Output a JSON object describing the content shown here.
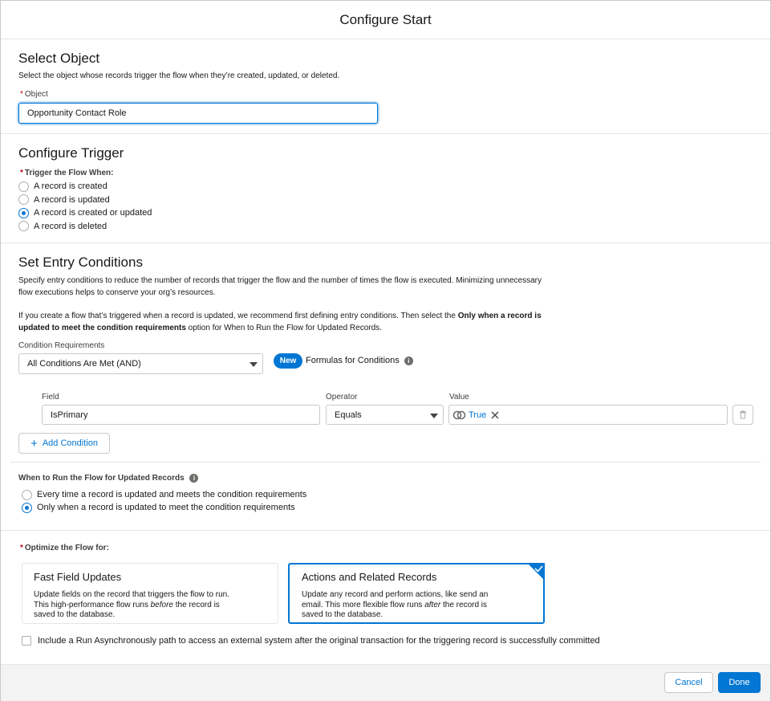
{
  "modal": {
    "title": "Configure Start"
  },
  "select_object": {
    "title": "Select Object",
    "description": "Select the object whose records trigger the flow when they’re created, updated, or deleted.",
    "required_mark": "*",
    "object_label": "Object",
    "object_value": "Opportunity Contact Role"
  },
  "trigger": {
    "title": "Configure Trigger",
    "required_mark": "*",
    "label": "Trigger the Flow When:",
    "options": [
      {
        "label": "A record is created",
        "selected": false
      },
      {
        "label": "A record is updated",
        "selected": false
      },
      {
        "label": "A record is created or updated",
        "selected": true
      },
      {
        "label": "A record is deleted",
        "selected": false
      }
    ]
  },
  "entry": {
    "title": "Set Entry Conditions",
    "desc1_line1": "Specify entry conditions to reduce the number of records that trigger the flow and the number of times the flow is executed. Minimizing unnecessary",
    "desc1_line2": "flow executions helps to conserve your org’s resources.",
    "desc2_part1": "If you create a flow that’s triggered when a record is updated, we recommend first defining entry conditions. Then select the ",
    "desc2_bold1": "Only when a record is",
    "desc2_bold2": "updated to meet the condition requirements",
    "desc2_part2": " option for When to Run the Flow for Updated Records.",
    "cond_req_label": "Condition Requirements",
    "cond_req_value": "All Conditions Are Met (AND)",
    "new_badge": "New",
    "formulas_label": "Formulas for Conditions",
    "info_glyph": "i",
    "col_field": "Field",
    "col_operator": "Operator",
    "col_value": "Value",
    "row": {
      "field": "IsPrimary",
      "operator": "Equals",
      "value": "True"
    },
    "add_condition_plus": "+",
    "add_condition": "Add Condition"
  },
  "when_run": {
    "label": "When to Run the Flow for Updated Records",
    "info_glyph": "i",
    "options": [
      {
        "label": "Every time a record is updated and meets the condition requirements",
        "selected": false
      },
      {
        "label": "Only when a record is updated to meet the condition requirements",
        "selected": true
      }
    ]
  },
  "optimize": {
    "required_mark": "*",
    "label": "Optimize the Flow for:",
    "card1": {
      "title": "Fast Field Updates",
      "line1": "Update fields on the record that triggers the flow to run.",
      "line2": "This high-performance flow runs ",
      "line2_em": "before",
      "line2_end": " the record is",
      "line3": "saved to the database."
    },
    "card2": {
      "title": "Actions and Related Records",
      "line1": "Update any record and perform actions, like send an",
      "line2": "email. This more flexible flow runs ",
      "line2_em": "after",
      "line2_end": " the record is",
      "line3": "saved to the database."
    },
    "async_label": "Include a Run Asynchronously path to access an external system after the original transaction for the triggering record is successfully committed"
  },
  "footer": {
    "cancel": "Cancel",
    "done": "Done"
  },
  "colors": {
    "brand": "#0176d3",
    "required": "#ba0517",
    "border": "#c9c9c9"
  },
  "icons": [
    "info-icon",
    "trash-icon",
    "close-icon",
    "chevron-down-icon",
    "checkmark-icon",
    "add-icon",
    "link-icon"
  ]
}
